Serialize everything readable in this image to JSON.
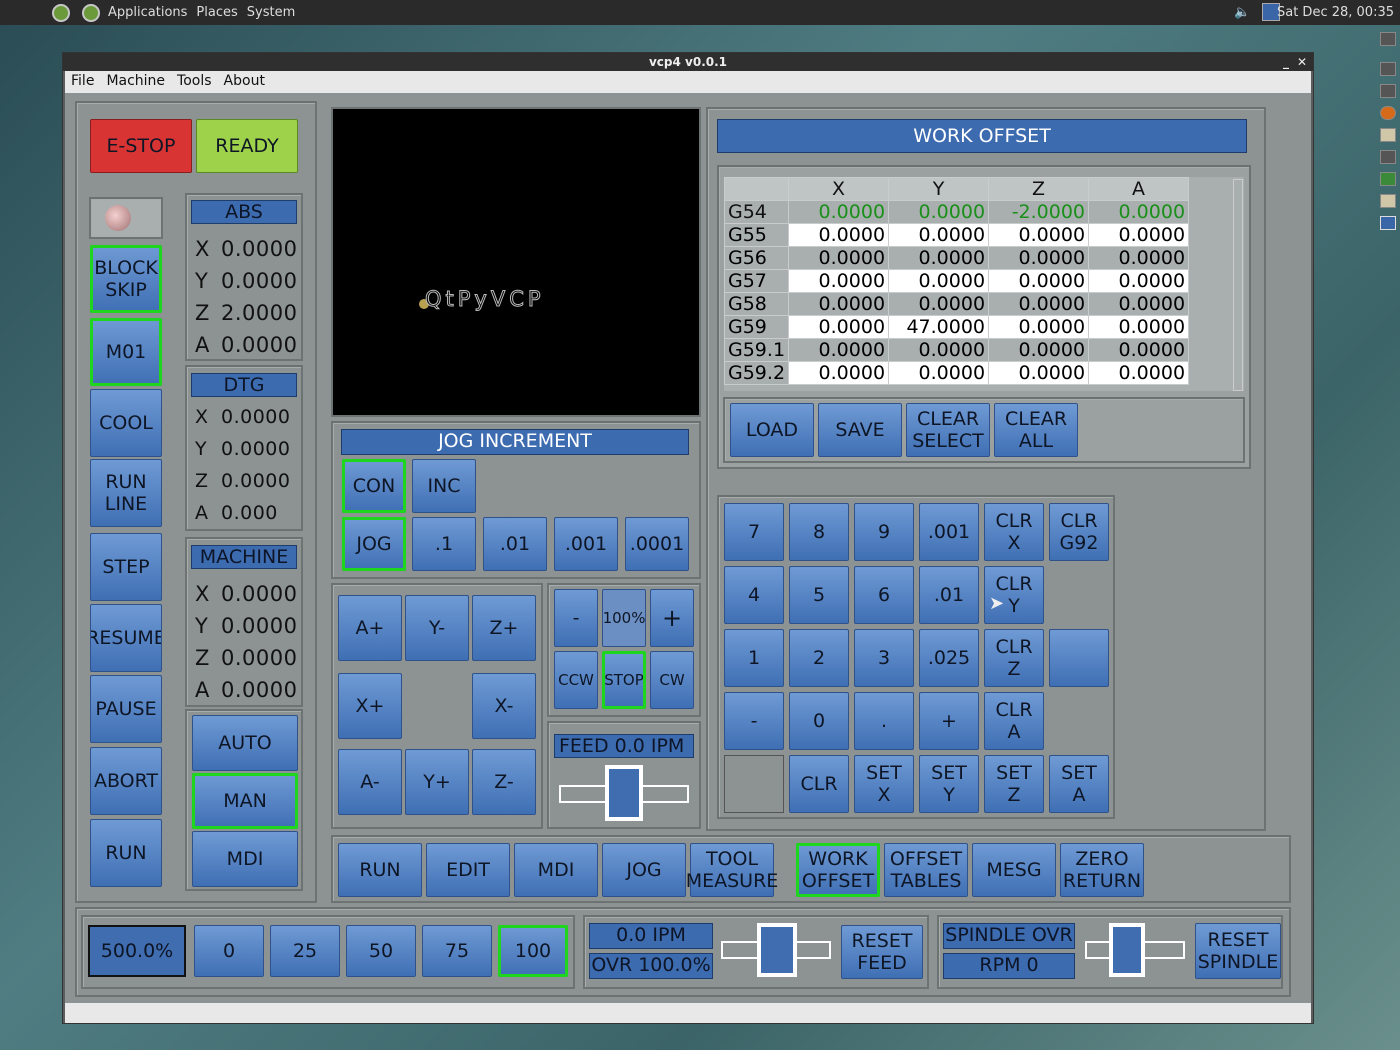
{
  "topbar": {
    "menu": [
      "Applications",
      "Places",
      "System"
    ],
    "clock": "Sat Dec 28, 00:35"
  },
  "window": {
    "title": "vcp4 v0.0.1",
    "menus": [
      "File",
      "Machine",
      "Tools",
      "About"
    ]
  },
  "controls": {
    "estop": "E-STOP",
    "ready": "READY",
    "left_buttons": [
      "BLOCK\nSKIP",
      "M01",
      "COOL",
      "RUN\nLINE",
      "STEP",
      "RESUME",
      "PAUSE",
      "ABORT",
      "RUN"
    ]
  },
  "dro": {
    "abs": {
      "title": "ABS",
      "rows": [
        {
          "axis": "X",
          "value": "0.0000"
        },
        {
          "axis": "Y",
          "value": "0.0000"
        },
        {
          "axis": "Z",
          "value": "2.0000"
        },
        {
          "axis": "A",
          "value": "0.0000"
        }
      ]
    },
    "dtg": {
      "title": "DTG",
      "rows": [
        {
          "axis": "X",
          "value": "0.0000"
        },
        {
          "axis": "Y",
          "value": "0.0000"
        },
        {
          "axis": "Z",
          "value": "0.0000"
        },
        {
          "axis": "A",
          "value": "0.000"
        }
      ]
    },
    "machine": {
      "title": "MACHINE",
      "rows": [
        {
          "axis": "X",
          "value": "0.0000"
        },
        {
          "axis": "Y",
          "value": "0.0000"
        },
        {
          "axis": "Z",
          "value": "0.0000"
        },
        {
          "axis": "A",
          "value": "0.0000"
        }
      ]
    }
  },
  "modes": {
    "auto": "AUTO",
    "man": "MAN",
    "mdi": "MDI"
  },
  "preview": {
    "logo": "QtPyVCP"
  },
  "jog": {
    "title": "JOG INCREMENT",
    "con": "CON",
    "inc": "INC",
    "jog": "JOG",
    "increments": [
      ".1",
      ".01",
      ".001",
      ".0001"
    ],
    "axis_buttons": {
      "aplus": "A+",
      "yminus": "Y-",
      "zplus": "Z+",
      "xplus": "X+",
      "xminus": "X-",
      "aminus": "A-",
      "yplus": "Y+",
      "zminus": "Z-"
    }
  },
  "spindle_jog": {
    "minus": "-",
    "pct": "100%",
    "plus": "+",
    "ccw": "CCW",
    "stop": "STOP",
    "cw": "CW"
  },
  "feed": {
    "label": "FEED 0.0  IPM"
  },
  "work_offset": {
    "title": "WORK OFFSET",
    "columns": [
      "X",
      "Y",
      "Z",
      "A"
    ],
    "rows": [
      {
        "name": "G54",
        "values": [
          "0.0000",
          "0.0000",
          "-2.0000",
          "0.0000"
        ]
      },
      {
        "name": "G55",
        "values": [
          "0.0000",
          "0.0000",
          "0.0000",
          "0.0000"
        ]
      },
      {
        "name": "G56",
        "values": [
          "0.0000",
          "0.0000",
          "0.0000",
          "0.0000"
        ]
      },
      {
        "name": "G57",
        "values": [
          "0.0000",
          "0.0000",
          "0.0000",
          "0.0000"
        ]
      },
      {
        "name": "G58",
        "values": [
          "0.0000",
          "0.0000",
          "0.0000",
          "0.0000"
        ]
      },
      {
        "name": "G59",
        "values": [
          "0.0000",
          "47.0000",
          "0.0000",
          "0.0000"
        ]
      },
      {
        "name": "G59.1",
        "values": [
          "0.0000",
          "0.0000",
          "0.0000",
          "0.0000"
        ]
      },
      {
        "name": "G59.2",
        "values": [
          "0.0000",
          "0.0000",
          "0.0000",
          "0.0000"
        ]
      }
    ],
    "active_color": "#1a8f1a",
    "buttons": [
      "LOAD",
      "SAVE",
      "CLEAR\nSELECT",
      "CLEAR\nALL"
    ]
  },
  "keypad": [
    [
      "7",
      "8",
      "9",
      ".001",
      "CLR\nX",
      "CLR\nG92"
    ],
    [
      "4",
      "5",
      "6",
      ".01",
      "CLR\nY",
      ""
    ],
    [
      "1",
      "2",
      "3",
      ".025",
      "CLR\nZ",
      " "
    ],
    [
      "-",
      "0",
      ".",
      "+",
      "CLR\nA",
      ""
    ],
    [
      "",
      "CLR",
      "SET\nX",
      "SET\nY",
      "SET\nZ",
      "SET\nA"
    ]
  ],
  "tabs": [
    "RUN",
    "EDIT",
    "MDI",
    "JOG",
    "TOOL\nMEASURE",
    "WORK\nOFFSET",
    "OFFSET\nTABLES",
    "MESG",
    "ZERO\nRETURN"
  ],
  "bottom": {
    "rapid": "500.0%",
    "rapid_presets": [
      "0",
      "25",
      "50",
      "75",
      "100"
    ],
    "feed_ipm": "0.0  IPM",
    "feed_ovr": "OVR 100.0%",
    "reset_feed": "RESET\nFEED",
    "spindle_ovr": "SPINDLE OVR",
    "rpm": "RPM 0",
    "reset_spindle": "RESET\nSPINDLE"
  }
}
